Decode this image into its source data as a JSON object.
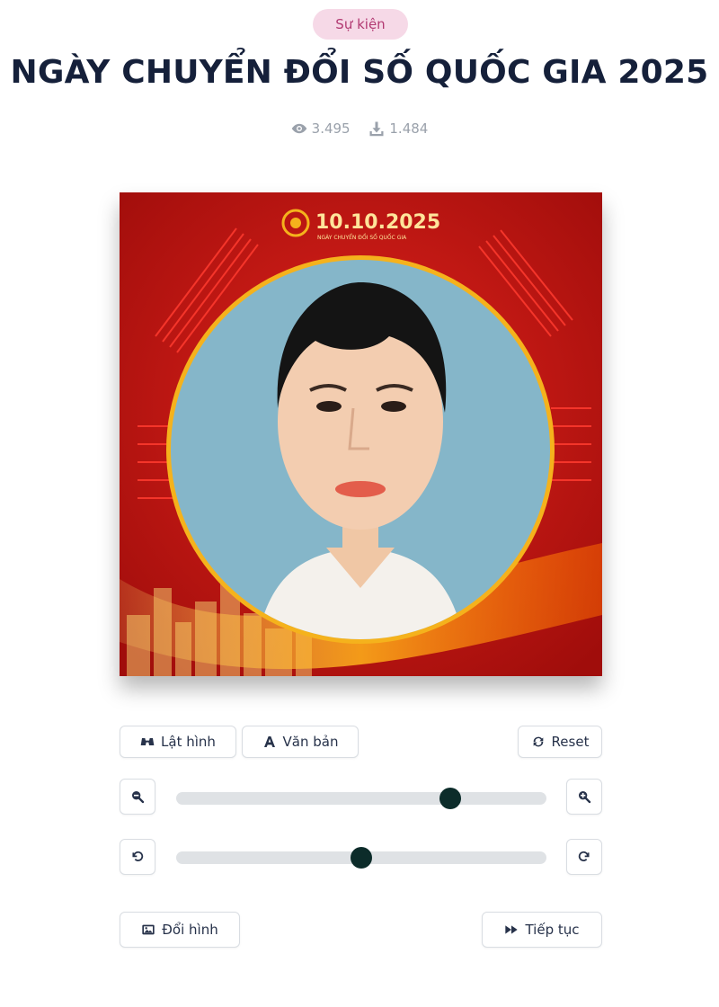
{
  "category_badge": "Sự kiện",
  "title": "NGÀY CHUYỂN ĐỔI SỐ QUỐC GIA 2025",
  "stats": {
    "views": "3.495",
    "downloads": "1.484"
  },
  "frame": {
    "date_text": "10.10.2025",
    "subtitle": "NGÀY CHUYỂN ĐỔI SỐ QUỐC GIA",
    "colors": {
      "background": "#c8120f",
      "ring": "#f5b21c",
      "photo_bg": "#85b6c9"
    }
  },
  "toolbar": {
    "flip_label": "Lật hình",
    "text_label": "Văn bản",
    "reset_label": "Reset"
  },
  "zoom": {
    "value": 0.74
  },
  "rotate": {
    "value": 0.5
  },
  "actions": {
    "change_image_label": "Đổi hình",
    "continue_label": "Tiếp tục"
  },
  "accent_color": "#0c2c2a"
}
